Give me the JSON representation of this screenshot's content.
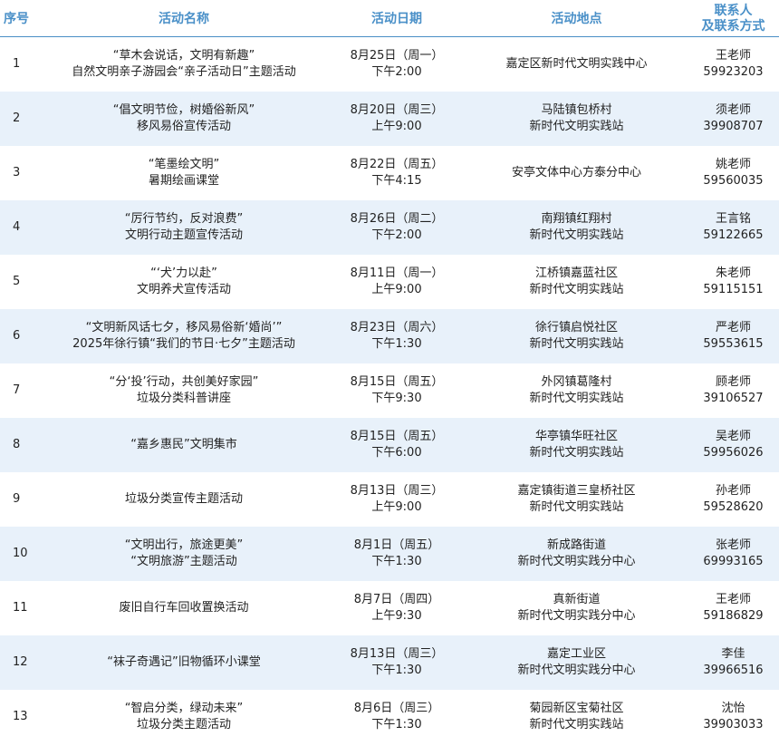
{
  "header": {
    "col_no": "序号",
    "col_name": "活动名称",
    "col_date": "活动日期",
    "col_place": "活动地点",
    "col_contact_line1": "联系人",
    "col_contact_line2": "及联系方式"
  },
  "rows": [
    {
      "no": "1",
      "name": [
        "“草木会说话，文明有新趣”",
        "自然文明亲子游园会“亲子活动日”主题活动"
      ],
      "date": [
        "8月25日（周一）",
        "下午2:00"
      ],
      "place": [
        "嘉定区新时代文明实践中心"
      ],
      "contact": [
        "王老师",
        "59923203"
      ]
    },
    {
      "no": "2",
      "name": [
        "“倡文明节俭，树婚俗新风”",
        "移风易俗宣传活动"
      ],
      "date": [
        "8月20日（周三）",
        "上午9:00"
      ],
      "place": [
        "马陆镇包桥村",
        "新时代文明实践站"
      ],
      "contact": [
        "须老师",
        "39908707"
      ]
    },
    {
      "no": "3",
      "name": [
        "“笔墨绘文明”",
        "暑期绘画课堂"
      ],
      "date": [
        "8月22日（周五）",
        "下午4:15"
      ],
      "place": [
        "安亭文体中心方泰分中心"
      ],
      "contact": [
        "姚老师",
        "59560035"
      ]
    },
    {
      "no": "4",
      "name": [
        "“厉行节约，反对浪费”",
        "文明行动主题宣传活动"
      ],
      "date": [
        "8月26日（周二）",
        "下午2:00"
      ],
      "place": [
        "南翔镇红翔村",
        "新时代文明实践站"
      ],
      "contact": [
        "王言铭",
        "59122665"
      ]
    },
    {
      "no": "5",
      "name": [
        "“‘犬’力以赴”",
        "文明养犬宣传活动"
      ],
      "date": [
        "8月11日（周一）",
        "上午9:00"
      ],
      "place": [
        "江桥镇嘉蓝社区",
        "新时代文明实践站"
      ],
      "contact": [
        "朱老师",
        "59115151"
      ]
    },
    {
      "no": "6",
      "name": [
        "“文明新风话七夕，移风易俗新‘婚尚’”",
        "2025年徐行镇“我们的节日·七夕”主题活动"
      ],
      "date": [
        "8月23日（周六）",
        "下午1:30"
      ],
      "place": [
        "徐行镇启悦社区",
        "新时代文明实践站"
      ],
      "contact": [
        "严老师",
        "59553615"
      ]
    },
    {
      "no": "7",
      "name": [
        "“分‘投’行动，共创美好家园”",
        "垃圾分类科普讲座"
      ],
      "date": [
        "8月15日（周五）",
        "下午9:30"
      ],
      "place": [
        "外冈镇葛隆村",
        "新时代文明实践站"
      ],
      "contact": [
        "顾老师",
        "39106527"
      ]
    },
    {
      "no": "8",
      "name": [
        "“嘉乡惠民”文明集市"
      ],
      "date": [
        "8月15日（周五）",
        "下午6:00"
      ],
      "place": [
        "华亭镇华旺社区",
        "新时代文明实践站"
      ],
      "contact": [
        "吴老师",
        "59956026"
      ]
    },
    {
      "no": "9",
      "name": [
        "垃圾分类宣传主题活动"
      ],
      "date": [
        "8月13日（周三）",
        "上午9:00"
      ],
      "place": [
        "嘉定镇街道三皇桥社区",
        "新时代文明实践站"
      ],
      "contact": [
        "孙老师",
        "59528620"
      ]
    },
    {
      "no": "10",
      "name": [
        "“文明出行，旅途更美”",
        "“文明旅游”主题活动"
      ],
      "date": [
        "8月1日（周五）",
        "下午1:30"
      ],
      "place": [
        "新成路街道",
        "新时代文明实践分中心"
      ],
      "contact": [
        "张老师",
        "69993165"
      ]
    },
    {
      "no": "11",
      "name": [
        "废旧自行车回收置换活动"
      ],
      "date": [
        "8月7日（周四）",
        "上午9:30"
      ],
      "place": [
        "真新街道",
        "新时代文明实践分中心"
      ],
      "contact": [
        "王老师",
        "59186829"
      ]
    },
    {
      "no": "12",
      "name": [
        "“袜子奇遇记”旧物循环小课堂"
      ],
      "date": [
        "8月13日（周三）",
        "下午1:30"
      ],
      "place": [
        "嘉定工业区",
        "新时代文明实践分中心"
      ],
      "contact": [
        "李佳",
        "39966516"
      ]
    },
    {
      "no": "13",
      "name": [
        "“智启分类，绿动未来”",
        "垃圾分类主题活动"
      ],
      "date": [
        "8月6日（周三）",
        "下午1:30"
      ],
      "place": [
        "菊园新区宝菊社区",
        "新时代文明实践站"
      ],
      "contact": [
        "沈怡",
        "39903033"
      ]
    }
  ],
  "colors": {
    "header_text": "#4a90c8",
    "header_rule": "#4a8fc5",
    "stripe": "#e8f1fa"
  }
}
